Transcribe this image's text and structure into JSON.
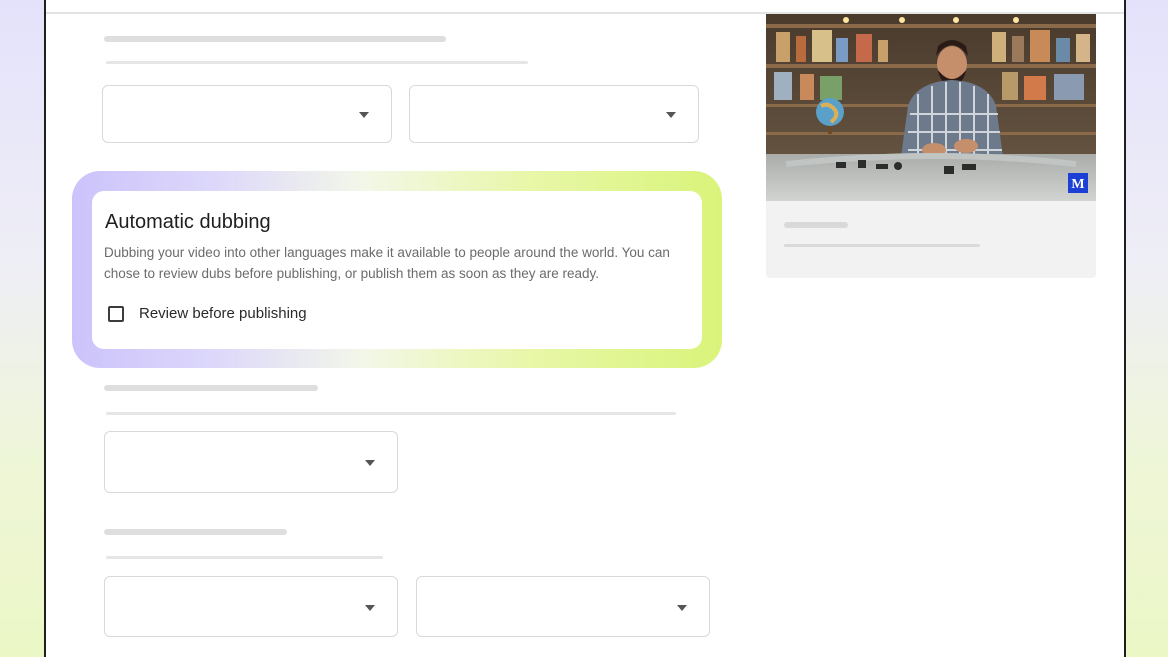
{
  "dubbing": {
    "title": "Automatic dubbing",
    "description": "Dubbing your video into other languages make it available to people around the world. You can chose to review dubs before publishing, or publish them as soon as they are ready.",
    "review_label": "Review before publishing",
    "review_checked": false
  },
  "video": {
    "badge_letter": "M"
  },
  "colors": {
    "highlight_start": "#cbc3fb",
    "highlight_end": "#d9f47a",
    "badge": "#1c3fd6"
  }
}
